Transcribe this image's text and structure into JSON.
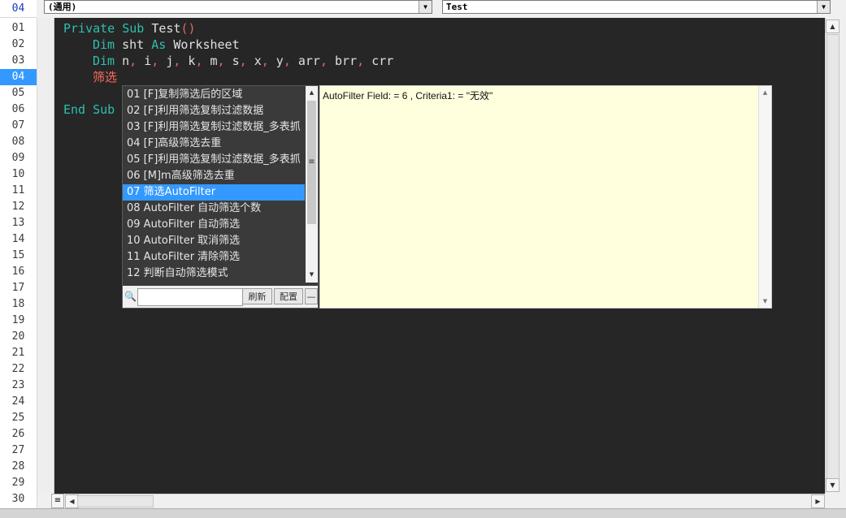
{
  "header": {
    "current_line": "04",
    "object_combo": "(通用)",
    "procedure_combo": "Test"
  },
  "gutter": {
    "lines": [
      "01",
      "02",
      "03",
      "04",
      "05",
      "06",
      "07",
      "08",
      "09",
      "10",
      "11",
      "12",
      "13",
      "14",
      "15",
      "16",
      "17",
      "18",
      "19",
      "20",
      "21",
      "22",
      "23",
      "24",
      "25",
      "26",
      "27",
      "28",
      "29",
      "30"
    ],
    "active_line": "04"
  },
  "code": {
    "line1": {
      "kw1": "Private",
      "kw2": "Sub",
      "name": "Test",
      "parens": "()"
    },
    "line2": {
      "kw1": "Dim",
      "name": "sht",
      "kw2": "As",
      "type": "Worksheet"
    },
    "line3": {
      "kw": "Dim",
      "vars": [
        "n",
        "i",
        "j",
        "k",
        "m",
        "s",
        "x",
        "y",
        "arr",
        "brr",
        "crr"
      ]
    },
    "line4": {
      "typing": "筛选"
    },
    "line6": {
      "kw1": "End",
      "kw2": "Sub"
    }
  },
  "popup": {
    "items": [
      "01 [F]复制筛选后的区域",
      "02 [F]利用筛选复制过滤数据",
      "03 [F]利用筛选复制过滤数据_多表抓",
      "04 [F]高级筛选去重",
      "05 [F]利用筛选复制过滤数据_多表抓",
      "06 [M]m高级筛选去重",
      "07 筛选AutoFilter",
      "08 AutoFilter 自动筛选个数",
      "09 AutoFilter 自动筛选",
      "10 AutoFilter 取消筛选",
      "11 AutoFilter 清除筛选",
      "12 判断自动筛选模式"
    ],
    "selected_index": 6,
    "search_value": "",
    "refresh_label": "刷新",
    "config_label": "配置",
    "collapse_label": "—"
  },
  "description": {
    "text": "AutoFilter Field: = 6 , Criteria1: = \"无效\""
  },
  "colors": {
    "editor_bg": "#262626",
    "keyword": "#2fbfb0",
    "operator": "#e06a5a",
    "selection": "#3399ff",
    "desc_bg": "#ffffde"
  }
}
